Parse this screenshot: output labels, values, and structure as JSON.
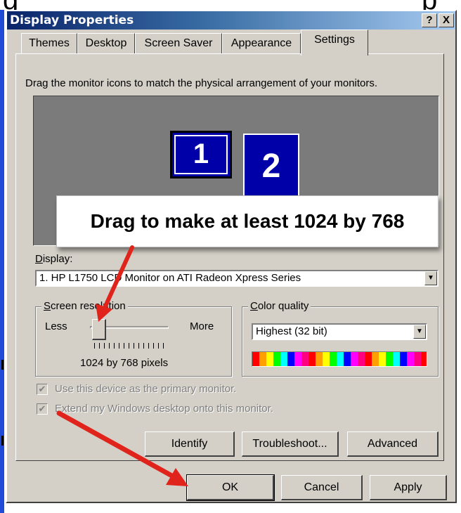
{
  "background": {
    "fragment_left": "g",
    "fragment_right": "p"
  },
  "window": {
    "title": "Display Properties",
    "help_btn": "?",
    "close_btn": "X"
  },
  "tabs": [
    {
      "label": "Themes"
    },
    {
      "label": "Desktop"
    },
    {
      "label": "Screen Saver"
    },
    {
      "label": "Appearance"
    },
    {
      "label": "Settings"
    }
  ],
  "active_tab": "Settings",
  "settings": {
    "instruction": "Drag the monitor icons to match the physical arrangement of your monitors.",
    "monitors": [
      {
        "number": "1"
      },
      {
        "number": "2"
      }
    ],
    "display_label": "Display:",
    "display_value": "1. HP L1750 LCD Monitor on ATI Radeon Xpress Series",
    "resolution": {
      "legend": "Screen resolution",
      "less": "Less",
      "more": "More",
      "value": "1024 by 768 pixels"
    },
    "color_quality": {
      "legend": "Color quality",
      "value": "Highest (32 bit)"
    },
    "primary_checkbox": "Use this device as the primary monitor.",
    "extend_checkbox": "Extend my Windows desktop onto this monitor.",
    "identify_btn": "Identify",
    "troubleshoot_btn": "Troubleshoot...",
    "advanced_btn": "Advanced"
  },
  "footer": {
    "ok": "OK",
    "cancel": "Cancel",
    "apply": "Apply"
  },
  "annotation": {
    "callout_text": "Drag to make at least 1024 by 768",
    "arrow_color": "#e0231b"
  },
  "colors": {
    "titlebar_start": "#0a246a",
    "titlebar_end": "#a6caf0",
    "dialog_face": "#d4d0c8",
    "monitor_blue": "#0000a8"
  }
}
